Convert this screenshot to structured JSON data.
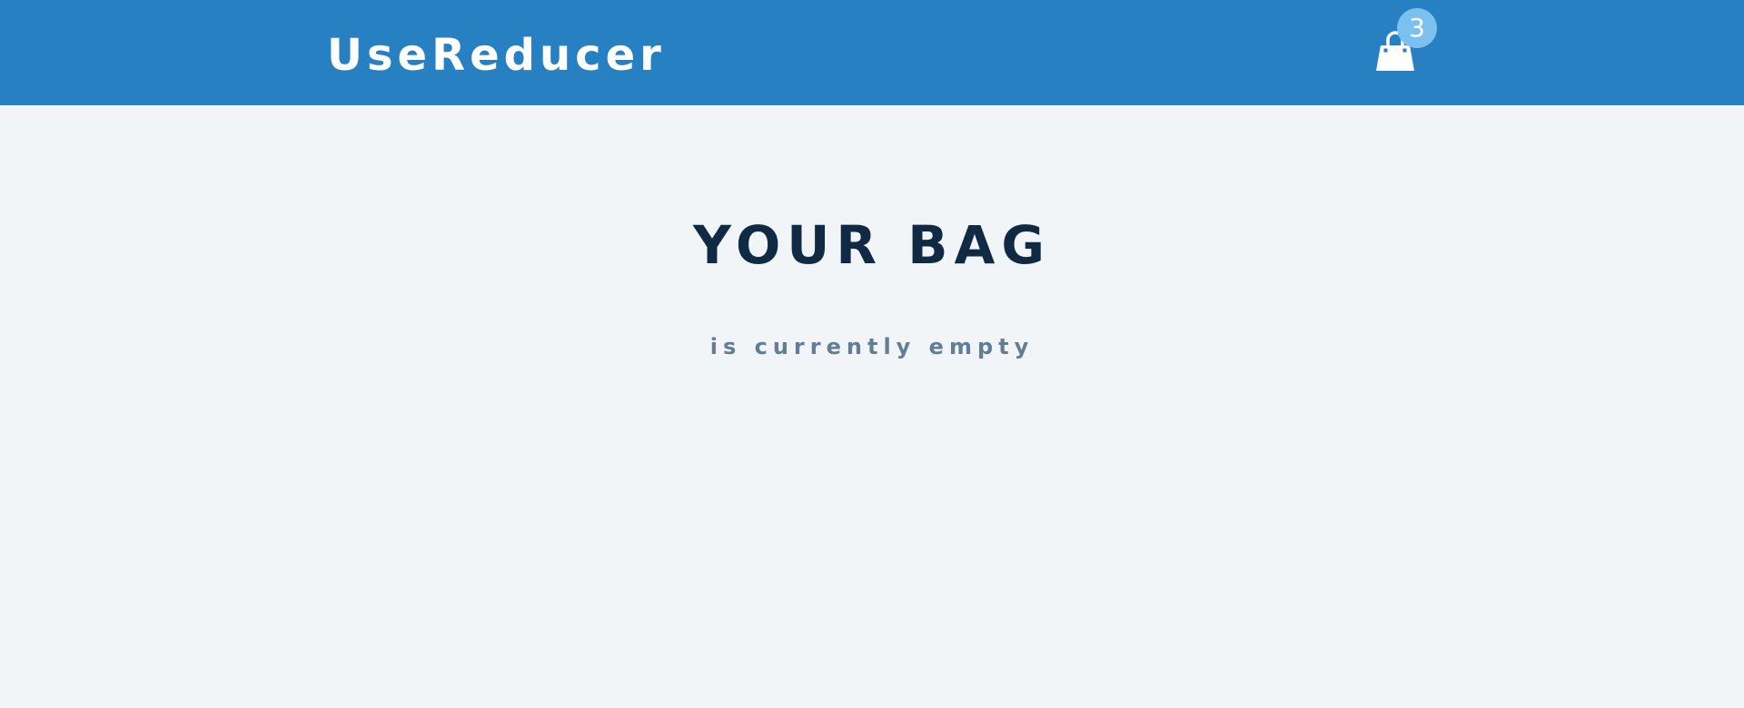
{
  "navbar": {
    "brand": "UseReducer",
    "cart_icon": "shopping-bag-icon",
    "cart_count": "3"
  },
  "bag": {
    "title": "YOUR BAG",
    "subtitle": "is currently empty"
  },
  "colors": {
    "navbar_bg": "#2680c2",
    "badge_bg": "#7cc0ef",
    "page_bg": "#f1f5f8",
    "title": "#102a43",
    "subtitle": "#617d98"
  }
}
